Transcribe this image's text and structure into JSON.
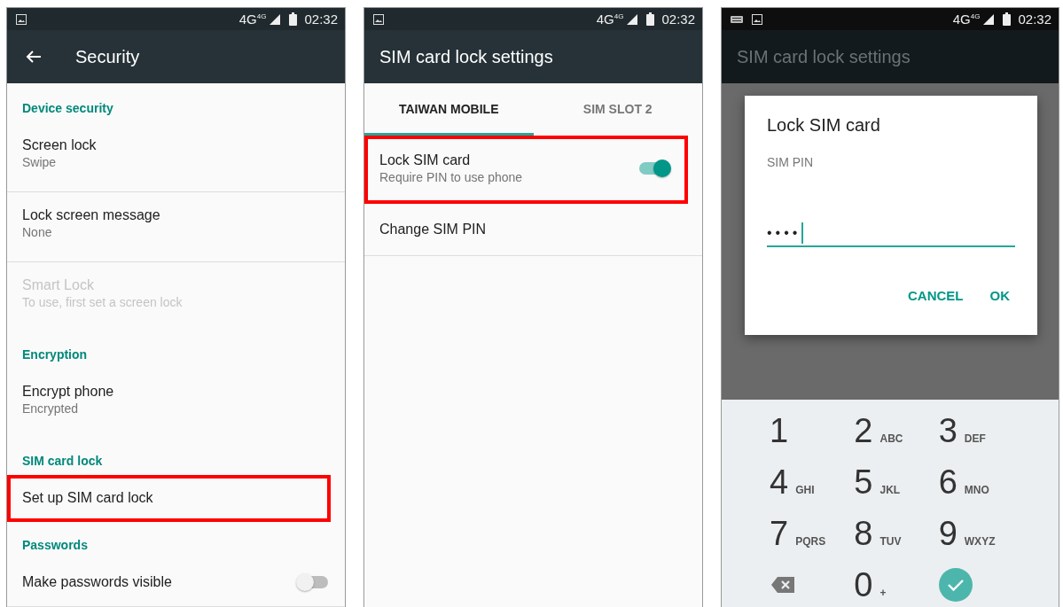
{
  "security": {
    "status_bar": {
      "keyboard_icon": false,
      "network": "4G",
      "network_badge": "4G",
      "time": "02:32"
    },
    "title": "Security",
    "back_button": true,
    "list": [
      {
        "kind": "header",
        "text": "Device security"
      },
      {
        "kind": "item",
        "title": "Screen lock",
        "summary": "Swipe",
        "disabled": false,
        "highlighted": false
      },
      {
        "kind": "item",
        "title": "Lock screen message",
        "summary": "None",
        "disabled": false,
        "highlighted": false
      },
      {
        "kind": "item",
        "title": "Smart Lock",
        "summary": "To use, first set a screen lock",
        "disabled": true,
        "highlighted": false
      },
      {
        "kind": "header",
        "text": "Encryption"
      },
      {
        "kind": "item",
        "title": "Encrypt phone",
        "summary": "Encrypted",
        "disabled": false,
        "highlighted": false
      },
      {
        "kind": "header",
        "text": "SIM card lock"
      },
      {
        "kind": "item",
        "title": "Set up SIM card lock",
        "disabled": false,
        "highlighted": true
      },
      {
        "kind": "header",
        "text": "Passwords"
      },
      {
        "kind": "toggle",
        "title": "Make passwords visible",
        "on": false,
        "highlighted": false
      }
    ]
  },
  "sim_lock_settings": {
    "status_bar": {
      "keyboard_icon": false,
      "network": "4G",
      "network_badge": "4G",
      "time": "02:32"
    },
    "title": "SIM card lock settings",
    "tabs": [
      {
        "label": "TAIWAN MOBILE",
        "selected": true
      },
      {
        "label": "SIM SLOT 2",
        "selected": false
      }
    ],
    "list": [
      {
        "kind": "toggle",
        "title": "Lock SIM card",
        "summary": "Require PIN to use phone",
        "on": true,
        "highlighted": true
      },
      {
        "kind": "item",
        "title": "Change SIM PIN",
        "highlighted": false
      }
    ]
  },
  "pin_dialog": {
    "status_bar": {
      "keyboard_icon": true,
      "network": "4G",
      "network_badge": "4G",
      "time": "02:32"
    },
    "title": "SIM card lock settings",
    "dialog": {
      "title": "Lock SIM card",
      "label": "SIM PIN",
      "value": "••••",
      "buttons": [
        "CANCEL",
        "OK"
      ]
    },
    "keypad": [
      {
        "kind": "digit",
        "digit": "1"
      },
      {
        "kind": "digit",
        "digit": "2",
        "letters": "ABC"
      },
      {
        "kind": "digit",
        "digit": "3",
        "letters": "DEF"
      },
      {
        "kind": "digit",
        "digit": "4",
        "letters": "GHI"
      },
      {
        "kind": "digit",
        "digit": "5",
        "letters": "JKL"
      },
      {
        "kind": "digit",
        "digit": "6",
        "letters": "MNO"
      },
      {
        "kind": "digit",
        "digit": "7",
        "letters": "PQRS"
      },
      {
        "kind": "digit",
        "digit": "8",
        "letters": "TUV"
      },
      {
        "kind": "digit",
        "digit": "9",
        "letters": "WXYZ"
      },
      {
        "kind": "backspace"
      },
      {
        "kind": "digit",
        "digit": "0",
        "letters": "+"
      },
      {
        "kind": "done"
      }
    ]
  }
}
